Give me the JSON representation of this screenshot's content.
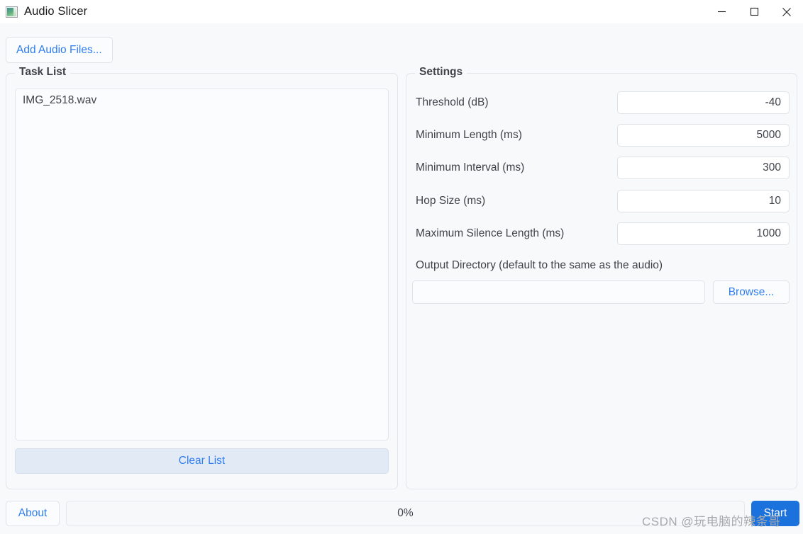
{
  "window": {
    "title": "Audio Slicer",
    "icon": "audio-slicer-app-icon",
    "controls": {
      "minimize": "minimize-icon",
      "maximize": "maximize-icon",
      "close": "close-icon"
    }
  },
  "toolbar": {
    "add_files_label": "Add Audio Files..."
  },
  "task_list": {
    "group_title": "Task List",
    "items": [
      {
        "name": "IMG_2518.wav"
      }
    ],
    "clear_label": "Clear List"
  },
  "settings": {
    "group_title": "Settings",
    "fields": [
      {
        "label": "Threshold (dB)",
        "value": "-40"
      },
      {
        "label": "Minimum Length (ms)",
        "value": "5000"
      },
      {
        "label": "Minimum Interval (ms)",
        "value": "300"
      },
      {
        "label": "Hop Size (ms)",
        "value": "10"
      },
      {
        "label": "Maximum Silence Length (ms)",
        "value": "1000"
      }
    ],
    "output_directory": {
      "label": "Output Directory (default to the same as the audio)",
      "value": "",
      "placeholder": "",
      "browse_label": "Browse..."
    }
  },
  "bottom_bar": {
    "about_label": "About",
    "progress": {
      "percent": 0,
      "text": "0%"
    },
    "start_label": "Start"
  },
  "watermark": {
    "text": "CSDN @玩电脑的辣条哥"
  },
  "colors": {
    "accent_link": "#2f7ef0",
    "start_button": "#1c72dd",
    "window_bg": "#f8f9fb",
    "titlebar_bg": "#ffffff",
    "border": "#e2e5e9",
    "text": "#3f4349",
    "clear_list_bg": "#e2eaf5",
    "watermark": "#a6a9ad"
  }
}
